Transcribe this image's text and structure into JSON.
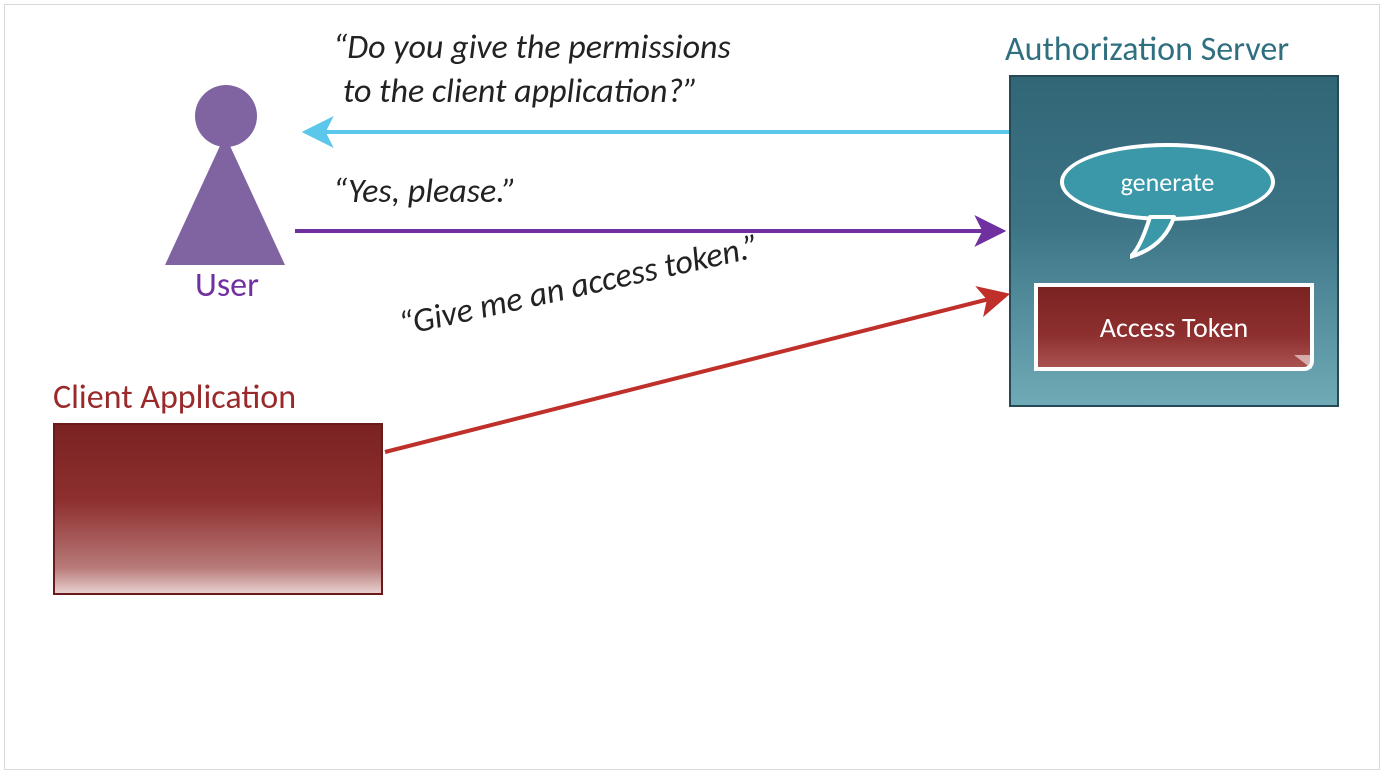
{
  "entities": {
    "user": {
      "label": "User"
    },
    "client": {
      "label": "Client Application"
    },
    "auth_server": {
      "label": "Authorization Server",
      "speech": "generate",
      "token": "Access Token"
    }
  },
  "messages": {
    "auth_to_user_line1": "“Do you give the permissions",
    "auth_to_user_line2": "to the client application?”",
    "user_to_auth": "“Yes, please.”",
    "client_to_auth": "“Give me an access token.”"
  },
  "colors": {
    "user": "#7030a0",
    "keyhole": "#8064a2",
    "client": "#9a2a2a",
    "auth": "#2f6f7f",
    "arrow_lightblue": "#5bc7ea",
    "arrow_purple": "#7030a0",
    "arrow_red": "#c0302b"
  }
}
